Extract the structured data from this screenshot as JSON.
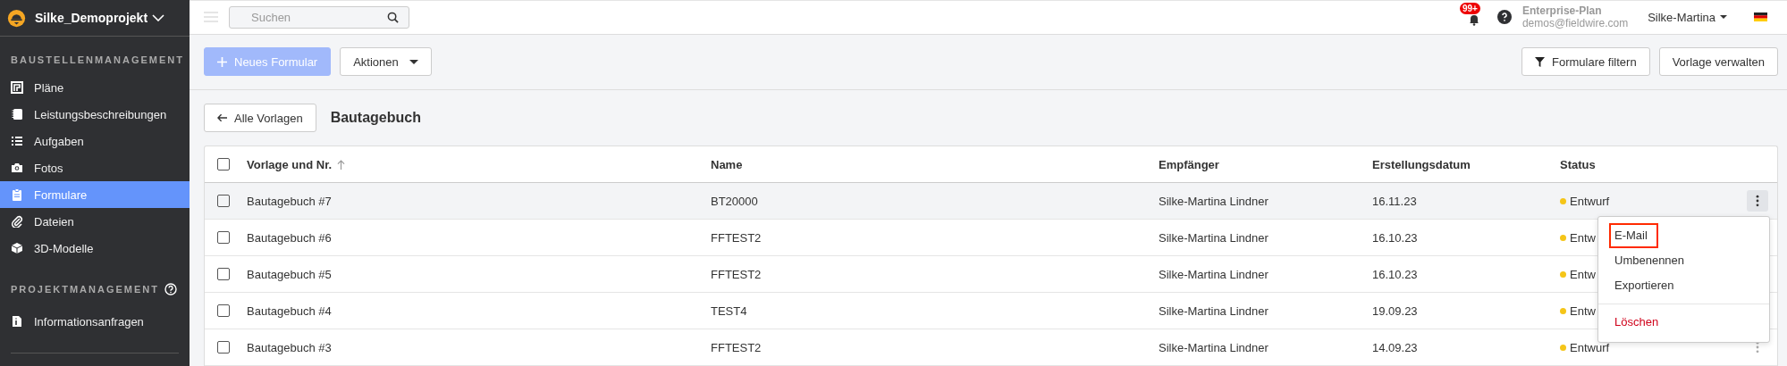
{
  "project": {
    "name": "Silke_Demoprojekt"
  },
  "sidebar": {
    "sections": [
      {
        "title": "BAUSTELLENMANAGEMENT",
        "help": false,
        "items": [
          {
            "label": "Pläne",
            "selected": false
          },
          {
            "label": "Leistungsbeschreibungen",
            "selected": false
          },
          {
            "label": "Aufgaben",
            "selected": false
          },
          {
            "label": "Fotos",
            "selected": false
          },
          {
            "label": "Formulare",
            "selected": true
          },
          {
            "label": "Dateien",
            "selected": false
          },
          {
            "label": "3D-Modelle",
            "selected": false
          }
        ]
      },
      {
        "title": "PROJEKTMANAGEMENT",
        "help": true,
        "items": [
          {
            "label": "Informationsanfragen",
            "selected": false
          }
        ]
      }
    ]
  },
  "topbar": {
    "search": {
      "placeholder": "Suchen"
    },
    "notifications": "99+",
    "plan": "Enterprise-Plan",
    "email": "demos@fieldwire.com",
    "user": "Silke-Martina"
  },
  "toolbar": {
    "left": [
      {
        "label": "Neues Formular",
        "kind": "primary",
        "disabled": true
      },
      {
        "label": "Aktionen",
        "kind": "dropdown",
        "disabled": false
      }
    ],
    "right": [
      {
        "label": "Formulare filtern",
        "kind": "filter",
        "disabled": false
      },
      {
        "label": "Vorlage verwalten",
        "kind": "plain",
        "disabled": false
      }
    ]
  },
  "header": {
    "back": "Alle Vorlagen",
    "title": "Bautagebuch"
  },
  "table": {
    "select_all_checked": false,
    "columns": [
      "Vorlage und Nr.",
      "Name",
      "Empfänger",
      "Erstellungsdatum",
      "Status"
    ],
    "rows": [
      {
        "template": "Bautagebuch #7",
        "name": "BT20000",
        "recipient": "Silke-Martina Lindner",
        "date": "16.11.23",
        "status": "Entwurf",
        "color": "#f5c518",
        "checked": false,
        "hovered": true,
        "menu_open": true
      },
      {
        "template": "Bautagebuch #6",
        "name": "FFTEST2",
        "recipient": "Silke-Martina Lindner",
        "date": "16.10.23",
        "status": "Entw",
        "color": "#f5c518",
        "checked": false,
        "hovered": false,
        "menu_open": false
      },
      {
        "template": "Bautagebuch #5",
        "name": "FFTEST2",
        "recipient": "Silke-Martina Lindner",
        "date": "16.10.23",
        "status": "Entw",
        "color": "#f5c518",
        "checked": false,
        "hovered": false,
        "menu_open": false
      },
      {
        "template": "Bautagebuch #4",
        "name": "TEST4",
        "recipient": "Silke-Martina Lindner",
        "date": "19.09.23",
        "status": "Entw",
        "color": "#f5c518",
        "checked": false,
        "hovered": false,
        "menu_open": false
      },
      {
        "template": "Bautagebuch #3",
        "name": "FFTEST2",
        "recipient": "Silke-Martina Lindner",
        "date": "14.09.23",
        "status": "Entwurf",
        "color": "#f5c518",
        "checked": false,
        "hovered": false,
        "menu_open": false
      }
    ]
  },
  "context_menu": {
    "items": [
      {
        "label": "E-Mail",
        "kind": "normal",
        "highlighted": true
      },
      {
        "label": "Umbenennen",
        "kind": "normal",
        "highlighted": false
      },
      {
        "label": "Exportieren",
        "kind": "normal",
        "highlighted": false
      },
      {
        "label": "Löschen",
        "kind": "danger",
        "highlighted": false
      }
    ]
  }
}
